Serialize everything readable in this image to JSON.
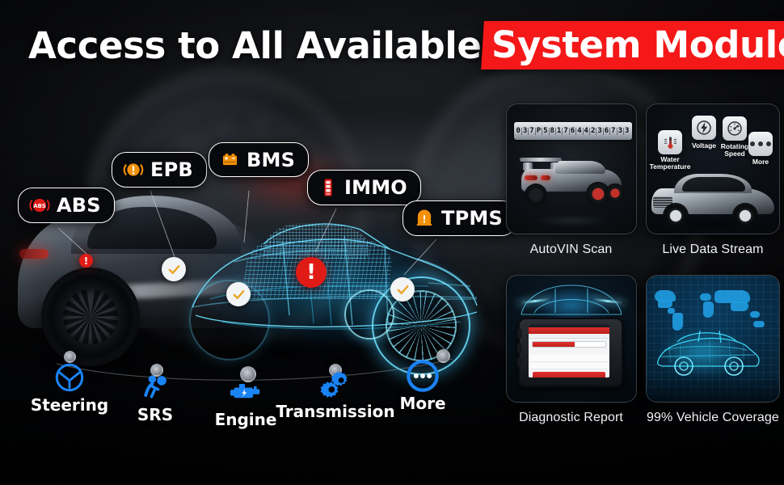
{
  "title": {
    "white_text": "Access to All Available",
    "highlight_text": "System Modules",
    "highlight_color": "#F41818"
  },
  "colors": {
    "accent_blue": "#1A83F5",
    "accent_orange": "#F29007",
    "alert_red": "#E01B16",
    "badge_border": "#FFFFFF",
    "wire_cyan": "#6EE1FF"
  },
  "badges": [
    {
      "label": "ABS",
      "icon": "abs-icon",
      "icon_color": "#E01B16"
    },
    {
      "label": "EPB",
      "icon": "epb-brake-warning-icon",
      "icon_color": "#F29007"
    },
    {
      "label": "BMS",
      "icon": "battery-icon",
      "icon_color": "#F29007"
    },
    {
      "label": "IMMO",
      "icon": "immobilizer-key-icon",
      "icon_color": "#E01B16"
    },
    {
      "label": "TPMS",
      "icon": "tire-pressure-icon",
      "icon_color": "#F29007"
    }
  ],
  "car_markers": [
    {
      "type": "alert",
      "name": "alert-marker-rear"
    },
    {
      "type": "ok",
      "name": "ok-marker-door"
    },
    {
      "type": "ok",
      "name": "ok-marker-sill"
    },
    {
      "type": "alert",
      "name": "alert-marker-engine"
    },
    {
      "type": "ok",
      "name": "ok-marker-wheel"
    }
  ],
  "modules": [
    {
      "label": "Steering",
      "icon": "steering-wheel-icon"
    },
    {
      "label": "SRS",
      "icon": "airbag-srs-icon"
    },
    {
      "label": "Engine",
      "icon": "engine-icon"
    },
    {
      "label": "Transmission",
      "icon": "gears-icon"
    },
    {
      "label": "More",
      "icon": "more-dots-icon"
    }
  ],
  "cards": [
    {
      "label": "AutoVIN Scan",
      "thumb": "vin-scan-thumb"
    },
    {
      "label": "Live Data Stream",
      "thumb": "live-data-thumb"
    },
    {
      "label": "Diagnostic Report",
      "thumb": "diagnostic-report-thumb"
    },
    {
      "label": "99% Vehicle Coverage",
      "thumb": "vehicle-coverage-thumb"
    }
  ],
  "vin_scan": {
    "digits": [
      "0",
      "3",
      "7",
      "P",
      "5",
      "8",
      "1",
      "7",
      "6",
      "4",
      "4",
      "2",
      "3",
      "6",
      "7",
      "3",
      "3"
    ]
  },
  "live_data": {
    "tiles": [
      {
        "label": "Water Temperature",
        "icon": "thermometer-icon"
      },
      {
        "label": "Voltage",
        "icon": "lightning-bolt-icon"
      },
      {
        "label": "Rotating Speed",
        "icon": "gauge-icon"
      },
      {
        "label": "More",
        "icon": "more-dots-icon"
      }
    ]
  }
}
